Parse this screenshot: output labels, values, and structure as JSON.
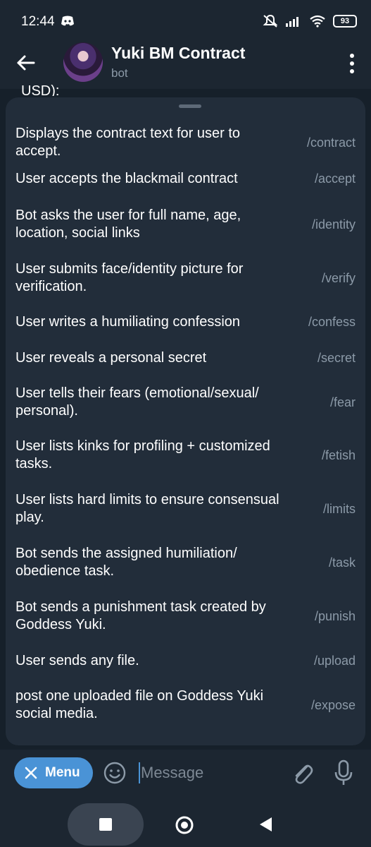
{
  "status": {
    "time": "12:44",
    "battery": "93"
  },
  "header": {
    "title": "Yuki BM Contract",
    "subtitle": "bot"
  },
  "chat": {
    "peek_text": "USD):"
  },
  "commands": [
    {
      "description": "Displays the contract text for user to accept.",
      "command": "/contract"
    },
    {
      "description": "User accepts the blackmail contract",
      "command": "/accept"
    },
    {
      "description": "Bot asks the user for full name, age, location, social links",
      "command": "/identity"
    },
    {
      "description": "User submits face/identity picture for verification.",
      "command": "/verify"
    },
    {
      "description": "User writes a humiliating confession",
      "command": "/confess"
    },
    {
      "description": "User reveals a personal secret",
      "command": "/secret"
    },
    {
      "description": "User tells their fears (emotional/sexual/ personal).",
      "command": "/fear"
    },
    {
      "description": "User lists kinks for profiling + customized tasks.",
      "command": "/fetish"
    },
    {
      "description": "User lists hard limits to ensure consensual play.",
      "command": "/limits"
    },
    {
      "description": "Bot sends the assigned humiliation/ obedience task.",
      "command": "/task"
    },
    {
      "description": "Bot sends a punishment task created by Goddess Yuki.",
      "command": "/punish"
    },
    {
      "description": "User sends any file.",
      "command": "/upload"
    },
    {
      "description": "post one uploaded file on Goddess Yuki social media.",
      "command": "/expose"
    }
  ],
  "input": {
    "menu_label": "Menu",
    "placeholder": "Message"
  },
  "colors": {
    "accent": "#4a93d6",
    "panel": "#222d3a",
    "secondary_text": "#8c9aa8"
  }
}
